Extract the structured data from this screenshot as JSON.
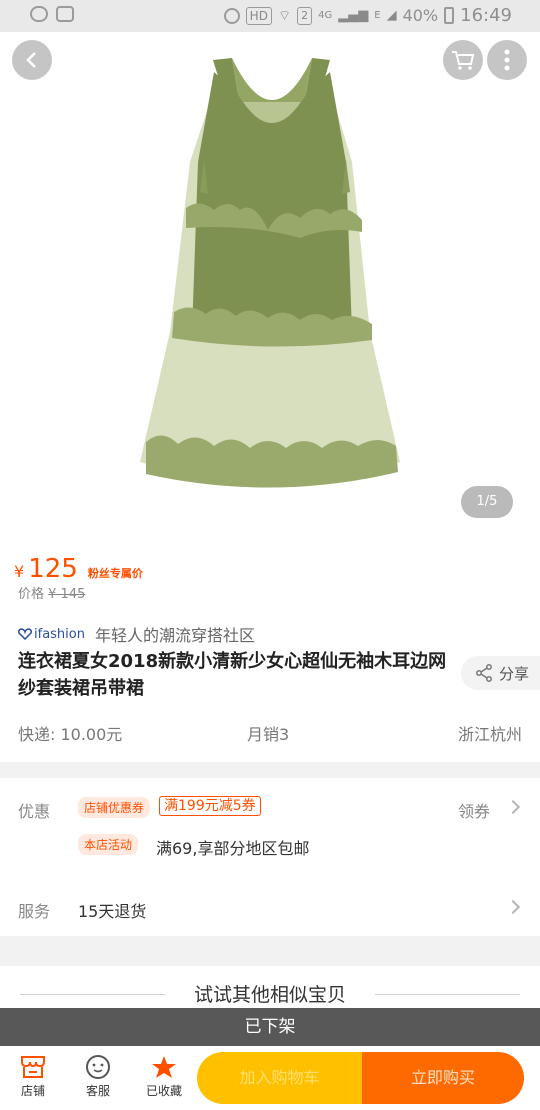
{
  "status_bar": {
    "hd": "HD",
    "sim_badge": "2",
    "network": "4G",
    "network2": "E",
    "battery": "40%",
    "time": "16:49"
  },
  "gallery": {
    "pager": "1/5",
    "dress_color": "#7e9150",
    "mesh_color": "#bfca98"
  },
  "product": {
    "currency": "¥",
    "price": "125",
    "fan_price_label": "粉丝专属价",
    "original_label": "价格",
    "original_price": "¥ 145",
    "brand_logo": "ifashion",
    "brand_slogan": "年轻人的潮流穿搭社区",
    "title": "连衣裙夏女2018新款小清新少女心超仙无袖木耳边网纱套装裙吊带裙",
    "share_label": "分享",
    "shipping": "快递: 10.00元",
    "monthly_sales": "月销3",
    "location": "浙江杭州"
  },
  "promo": {
    "discount_label": "优惠",
    "shop_coupon_tag": "店铺优惠券",
    "coupon_text": "满199元减5券",
    "claim_label": "领券",
    "activity_tag": "本店活动",
    "activity_text": "满69,享部分地区包邮",
    "service_label": "服务",
    "service_value": "15天退货"
  },
  "similar": {
    "label": "试试其他相似宝贝"
  },
  "delisted": "已下架",
  "bottom_nav": {
    "shop": "店铺",
    "service": "客服",
    "favorited": "已收藏",
    "add_to_cart": "加入购物车",
    "buy_now": "立即购买"
  },
  "colors": {
    "accent": "#ff5000",
    "cart_button": "#ffc000",
    "buy_button": "#ff6a00"
  }
}
